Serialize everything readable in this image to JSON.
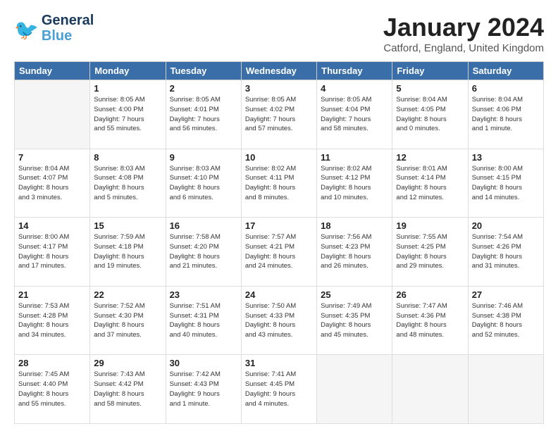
{
  "logo": {
    "general": "General",
    "blue": "Blue"
  },
  "title": "January 2024",
  "subtitle": "Catford, England, United Kingdom",
  "days_of_week": [
    "Sunday",
    "Monday",
    "Tuesday",
    "Wednesday",
    "Thursday",
    "Friday",
    "Saturday"
  ],
  "weeks": [
    [
      {
        "day": "",
        "info": ""
      },
      {
        "day": "1",
        "info": "Sunrise: 8:05 AM\nSunset: 4:00 PM\nDaylight: 7 hours\nand 55 minutes."
      },
      {
        "day": "2",
        "info": "Sunrise: 8:05 AM\nSunset: 4:01 PM\nDaylight: 7 hours\nand 56 minutes."
      },
      {
        "day": "3",
        "info": "Sunrise: 8:05 AM\nSunset: 4:02 PM\nDaylight: 7 hours\nand 57 minutes."
      },
      {
        "day": "4",
        "info": "Sunrise: 8:05 AM\nSunset: 4:04 PM\nDaylight: 7 hours\nand 58 minutes."
      },
      {
        "day": "5",
        "info": "Sunrise: 8:04 AM\nSunset: 4:05 PM\nDaylight: 8 hours\nand 0 minutes."
      },
      {
        "day": "6",
        "info": "Sunrise: 8:04 AM\nSunset: 4:06 PM\nDaylight: 8 hours\nand 1 minute."
      }
    ],
    [
      {
        "day": "7",
        "info": "Sunrise: 8:04 AM\nSunset: 4:07 PM\nDaylight: 8 hours\nand 3 minutes."
      },
      {
        "day": "8",
        "info": "Sunrise: 8:03 AM\nSunset: 4:08 PM\nDaylight: 8 hours\nand 5 minutes."
      },
      {
        "day": "9",
        "info": "Sunrise: 8:03 AM\nSunset: 4:10 PM\nDaylight: 8 hours\nand 6 minutes."
      },
      {
        "day": "10",
        "info": "Sunrise: 8:02 AM\nSunset: 4:11 PM\nDaylight: 8 hours\nand 8 minutes."
      },
      {
        "day": "11",
        "info": "Sunrise: 8:02 AM\nSunset: 4:12 PM\nDaylight: 8 hours\nand 10 minutes."
      },
      {
        "day": "12",
        "info": "Sunrise: 8:01 AM\nSunset: 4:14 PM\nDaylight: 8 hours\nand 12 minutes."
      },
      {
        "day": "13",
        "info": "Sunrise: 8:00 AM\nSunset: 4:15 PM\nDaylight: 8 hours\nand 14 minutes."
      }
    ],
    [
      {
        "day": "14",
        "info": "Sunrise: 8:00 AM\nSunset: 4:17 PM\nDaylight: 8 hours\nand 17 minutes."
      },
      {
        "day": "15",
        "info": "Sunrise: 7:59 AM\nSunset: 4:18 PM\nDaylight: 8 hours\nand 19 minutes."
      },
      {
        "day": "16",
        "info": "Sunrise: 7:58 AM\nSunset: 4:20 PM\nDaylight: 8 hours\nand 21 minutes."
      },
      {
        "day": "17",
        "info": "Sunrise: 7:57 AM\nSunset: 4:21 PM\nDaylight: 8 hours\nand 24 minutes."
      },
      {
        "day": "18",
        "info": "Sunrise: 7:56 AM\nSunset: 4:23 PM\nDaylight: 8 hours\nand 26 minutes."
      },
      {
        "day": "19",
        "info": "Sunrise: 7:55 AM\nSunset: 4:25 PM\nDaylight: 8 hours\nand 29 minutes."
      },
      {
        "day": "20",
        "info": "Sunrise: 7:54 AM\nSunset: 4:26 PM\nDaylight: 8 hours\nand 31 minutes."
      }
    ],
    [
      {
        "day": "21",
        "info": "Sunrise: 7:53 AM\nSunset: 4:28 PM\nDaylight: 8 hours\nand 34 minutes."
      },
      {
        "day": "22",
        "info": "Sunrise: 7:52 AM\nSunset: 4:30 PM\nDaylight: 8 hours\nand 37 minutes."
      },
      {
        "day": "23",
        "info": "Sunrise: 7:51 AM\nSunset: 4:31 PM\nDaylight: 8 hours\nand 40 minutes."
      },
      {
        "day": "24",
        "info": "Sunrise: 7:50 AM\nSunset: 4:33 PM\nDaylight: 8 hours\nand 43 minutes."
      },
      {
        "day": "25",
        "info": "Sunrise: 7:49 AM\nSunset: 4:35 PM\nDaylight: 8 hours\nand 45 minutes."
      },
      {
        "day": "26",
        "info": "Sunrise: 7:47 AM\nSunset: 4:36 PM\nDaylight: 8 hours\nand 48 minutes."
      },
      {
        "day": "27",
        "info": "Sunrise: 7:46 AM\nSunset: 4:38 PM\nDaylight: 8 hours\nand 52 minutes."
      }
    ],
    [
      {
        "day": "28",
        "info": "Sunrise: 7:45 AM\nSunset: 4:40 PM\nDaylight: 8 hours\nand 55 minutes."
      },
      {
        "day": "29",
        "info": "Sunrise: 7:43 AM\nSunset: 4:42 PM\nDaylight: 8 hours\nand 58 minutes."
      },
      {
        "day": "30",
        "info": "Sunrise: 7:42 AM\nSunset: 4:43 PM\nDaylight: 9 hours\nand 1 minute."
      },
      {
        "day": "31",
        "info": "Sunrise: 7:41 AM\nSunset: 4:45 PM\nDaylight: 9 hours\nand 4 minutes."
      },
      {
        "day": "",
        "info": ""
      },
      {
        "day": "",
        "info": ""
      },
      {
        "day": "",
        "info": ""
      }
    ]
  ]
}
